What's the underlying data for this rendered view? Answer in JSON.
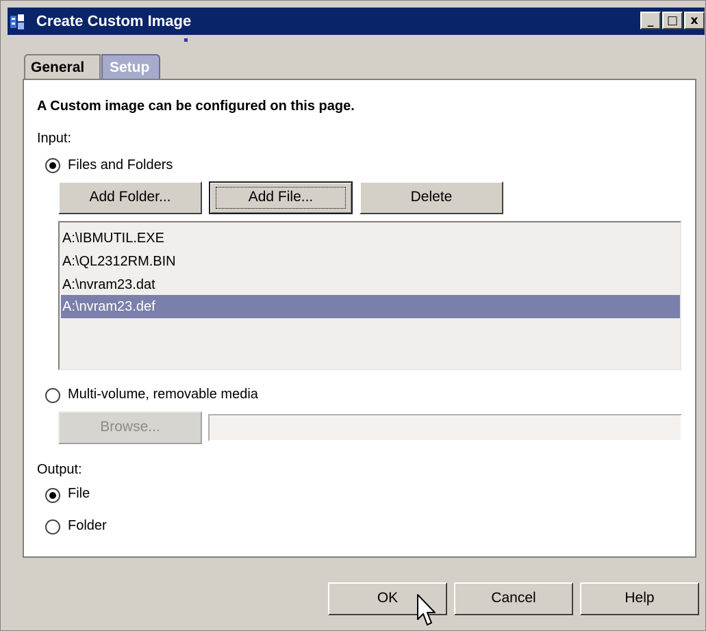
{
  "window": {
    "title": "Create Custom Image",
    "controls": {
      "minimize": "_",
      "maximize": "□",
      "close": "x"
    },
    "title_bar_color": "#0a246a"
  },
  "tabs": [
    {
      "label": "General",
      "active": false
    },
    {
      "label": "Setup",
      "active": true
    }
  ],
  "page": {
    "heading": "A Custom image can be configured on this page.",
    "input": {
      "label": "Input:",
      "files_and_folders": {
        "label": "Files and Folders",
        "selected": true
      },
      "buttons": {
        "add_folder": "Add Folder...",
        "add_file": "Add File...",
        "delete": "Delete"
      },
      "files": [
        {
          "name": "A:\\IBMUTIL.EXE",
          "selected": false
        },
        {
          "name": "A:\\QL2312RM.BIN",
          "selected": false
        },
        {
          "name": "A:\\nvram23.dat",
          "selected": false
        },
        {
          "name": "A:\\nvram23.def",
          "selected": true
        }
      ],
      "multi_volume": {
        "label": "Multi-volume, removable media",
        "selected": false
      },
      "browse_button": "Browse...",
      "browse_path": ""
    },
    "output": {
      "label": "Output:",
      "file": {
        "label": "File",
        "selected": true
      },
      "folder": {
        "label": "Folder",
        "selected": false
      }
    }
  },
  "footer": {
    "ok": "OK",
    "cancel": "Cancel",
    "help": "Help"
  },
  "colors": {
    "selection": "#7b7fab",
    "dialog_bg": "#d4d0c8",
    "active_tab": "#a6aacb"
  }
}
